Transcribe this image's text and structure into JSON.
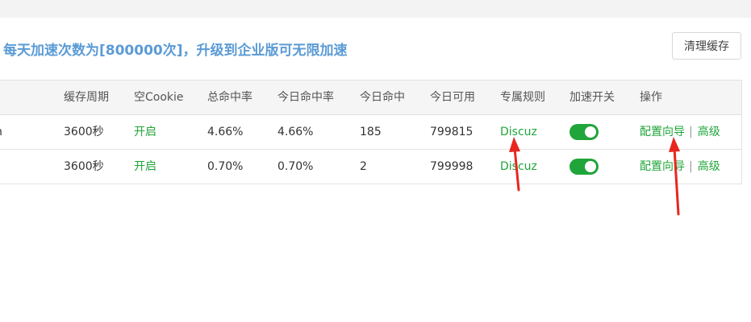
{
  "notice": "每天加速次数为[800000次]，升级到企业版可无限加速",
  "clear_cache_button": "清理缓存",
  "columns": [
    "缓存周期",
    "空Cookie",
    "总命中率",
    "今日命中率",
    "今日命中",
    "今日可用",
    "专属规则",
    "加速开关",
    "操作"
  ],
  "rows": [
    {
      "site_fragment": "n",
      "cache_period": "3600秒",
      "empty_cookie": "开启",
      "total_hit_rate": "4.66%",
      "today_hit_rate": "4.66%",
      "today_hits": "185",
      "today_available": "799815",
      "rule": "Discuz",
      "accelerate_on": true,
      "config_wizard": "配置向导",
      "separator": "|",
      "advanced": "高级"
    },
    {
      "site_fragment": "",
      "cache_period": "3600秒",
      "empty_cookie": "开启",
      "total_hit_rate": "0.70%",
      "today_hit_rate": "0.70%",
      "today_hits": "2",
      "today_available": "799998",
      "rule": "Discuz",
      "accelerate_on": true,
      "config_wizard": "配置向导",
      "separator": "|",
      "advanced": "高级"
    }
  ],
  "colors": {
    "accent_green": "#20a53a",
    "notice_blue": "#5b9bd5",
    "arrow_red": "#e8261e"
  }
}
